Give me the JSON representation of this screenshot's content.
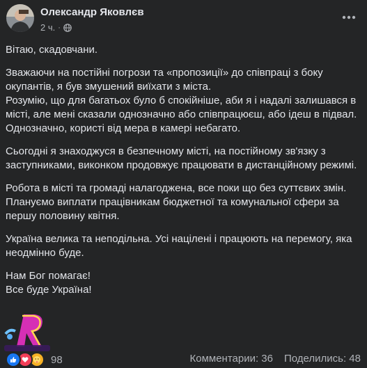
{
  "post": {
    "author": "Олександр Яковлєв",
    "time": "2 ч.",
    "separator": "·",
    "privacy_icon": "globe-icon",
    "more_icon": "more-horizontal-icon",
    "paragraphs": [
      "Вітаю, скадовчани.",
      "Зважаючи на постійні погрози та «пропозиції» до співпраці з боку окупантів, я був змушений виїхати з міста.\nРозумію, що для багатьох було б спокійніше, аби я і надалі залишався в місті, але мені сказали однозначно або співпрацюєш, або ідеш в підвал. Однозначно, користі від мера в камері небагато.",
      "Сьогодні я знаходжуся в безпечному місті, на постійному зв'язку з заступниками, виконком продовжує працювати в дистанційному режимі.",
      "Робота в місті та громаді налагоджена, все поки що без суттєвих змін.\nПлануємо виплати працівникам бюджетної та комунальної сфери за першу половину квітня.",
      "Україна велика та неподільна. Усі націлені і працюють на перемогу, яка неодмінно буде.",
      "Нам Бог помагає!\nВсе буде Україна!"
    ]
  },
  "footer": {
    "reactions": [
      "like-icon",
      "love-icon",
      "care-icon"
    ],
    "reaction_count": "98",
    "comments": "Комментарии: 36",
    "shares": "Поделились: 48"
  },
  "colors": {
    "background": "#242526",
    "text": "#e4e6eb",
    "secondary": "#b0b3b8",
    "like": "#1877f2",
    "love": "#f33e58"
  }
}
